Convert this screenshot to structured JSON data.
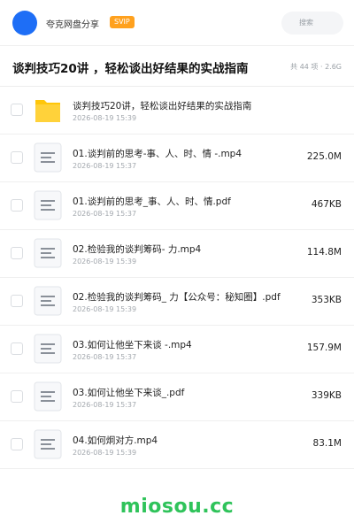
{
  "header": {
    "app_name": "夸克网盘分享",
    "badge": "SVIP",
    "search_placeholder": "搜索"
  },
  "folder": {
    "title": "谈判技巧20讲 ，轻松谈出好结果的实战指南",
    "meta": "共 44 项 · 2.6G"
  },
  "files": [
    {
      "type": "folder",
      "name": "谈判技巧20讲，轻松谈出好结果的实战指南",
      "date": "2026-08-19 15:39",
      "size": ""
    },
    {
      "type": "file",
      "name": "01.谈判前的思考-事、人、时、情 -.mp4",
      "date": "2026-08-19 15:37",
      "size": "225.0M"
    },
    {
      "type": "file",
      "name": "01.谈判前的思考_事、人、时、情.pdf",
      "date": "2026-08-19 15:37",
      "size": "467KB"
    },
    {
      "type": "file",
      "name": "02.检验我的谈判筹码- 力.mp4",
      "date": "2026-08-19 15:39",
      "size": "114.8M"
    },
    {
      "type": "file",
      "name": "02.检验我的谈判筹码_ 力【公众号：秘知圈】.pdf",
      "date": "2026-08-19 15:39",
      "size": "353KB"
    },
    {
      "type": "file",
      "name": "03.如何让他坐下来谈 -.mp4",
      "date": "2026-08-19 15:37",
      "size": "157.9M"
    },
    {
      "type": "file",
      "name": "03.如何让他坐下来谈_.pdf",
      "date": "2026-08-19 15:37",
      "size": "339KB"
    },
    {
      "type": "file",
      "name": "04.如何炯对方.mp4",
      "date": "2026-08-19 15:39",
      "size": "83.1M"
    }
  ],
  "watermark": "miosou.cc",
  "colors": {
    "accent": "#1e6ef6",
    "badge": "#ffa11e",
    "folder": "#ffc60a",
    "watermark": "#2fc35a"
  }
}
